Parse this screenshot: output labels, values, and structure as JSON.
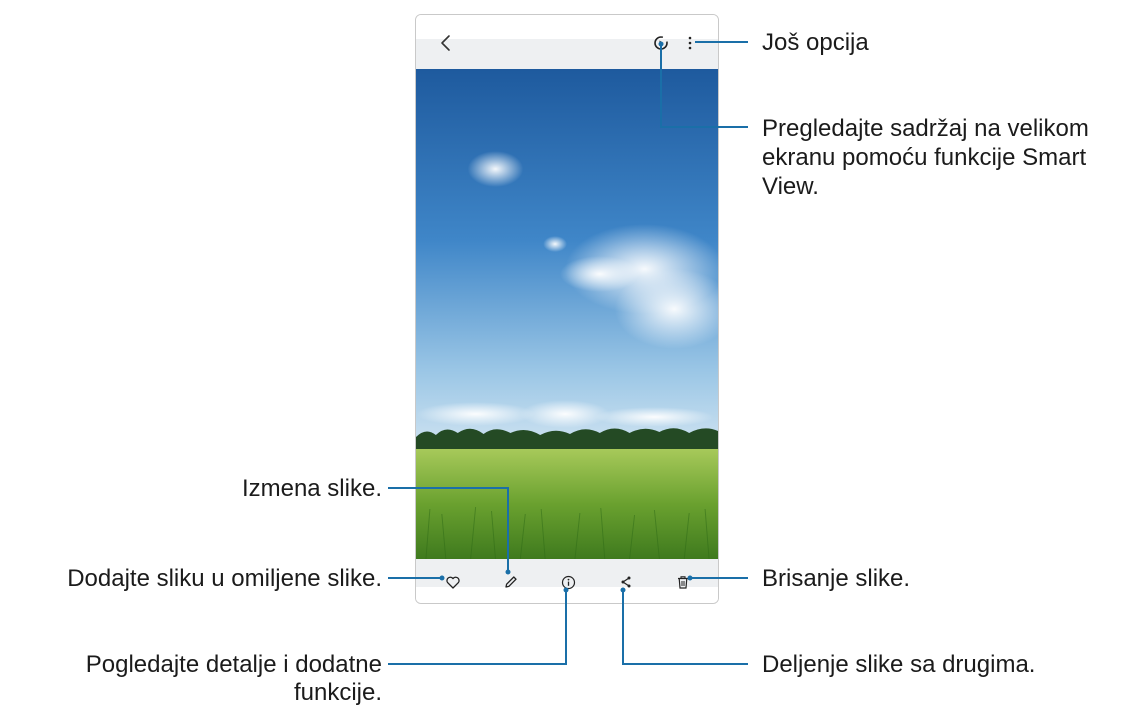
{
  "callouts": {
    "more_options": "Još opcija",
    "smart_view": [
      "Pregledajte sadržaj na velikom",
      "ekranu pomoću funkcije Smart",
      "View."
    ],
    "edit": "Izmena slike.",
    "favorite": "Dodajte sliku u omiljene slike.",
    "delete": "Brisanje slike.",
    "details": [
      "Pogledajte detalje i dodatne",
      "funkcije."
    ],
    "share": "Deljenje slike sa drugima."
  },
  "icons": {
    "top": [
      "back-icon",
      "smart-view-icon",
      "more-options-icon"
    ],
    "bottom": [
      "favorite-heart-icon",
      "edit-pencil-icon",
      "details-info-icon",
      "share-icon",
      "delete-trash-icon"
    ]
  },
  "colors": {
    "callout_line": "#1a6fa8",
    "bar_background": "#eef0f2"
  }
}
